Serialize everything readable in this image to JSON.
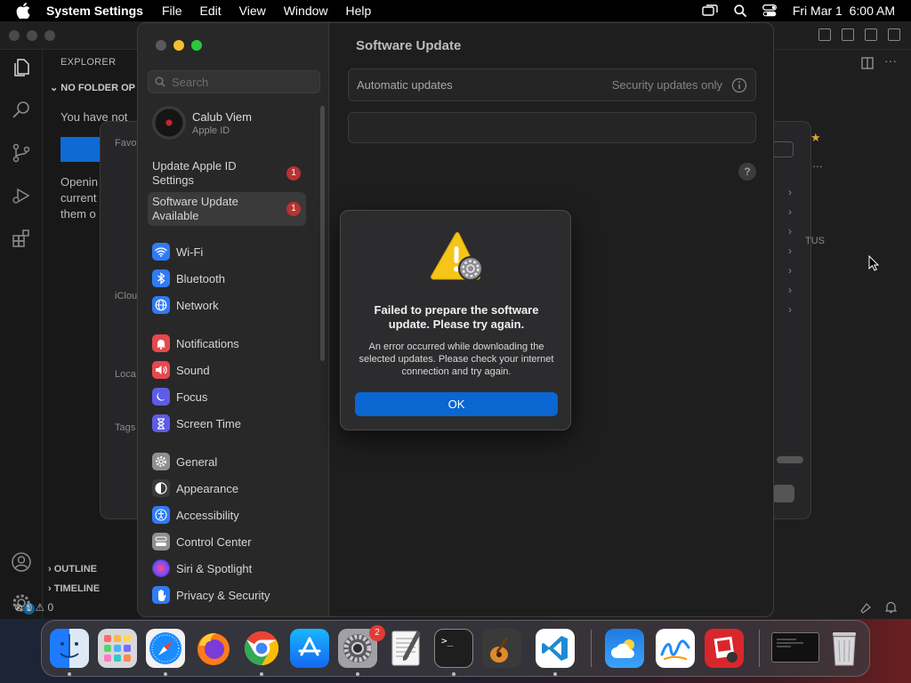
{
  "menubar": {
    "app_name": "System Settings",
    "menus": [
      "File",
      "Edit",
      "View",
      "Window",
      "Help"
    ],
    "datetime": "Fri Mar 1  6:00 AM"
  },
  "vscode": {
    "explorer_title": "EXPLORER",
    "folder_header": "NO FOLDER OP",
    "no_folder_text": "You have not",
    "opening_text_lines": [
      "Openin",
      "current",
      "them o"
    ],
    "outline": "OUTLINE",
    "timeline": "TIMELINE",
    "status": "⊗ 0 ⚠ 0",
    "accounts_badge": "1"
  },
  "finder": {
    "labels": [
      "Favo",
      "iClou",
      "Loca",
      "Tags"
    ],
    "tus": "TUS"
  },
  "settings": {
    "search_placeholder": "Search",
    "account": {
      "name": "Calub Viem",
      "subtitle": "Apple ID"
    },
    "notices": [
      {
        "label": "Update Apple ID Settings",
        "badge": "1"
      },
      {
        "label": "Software Update Available",
        "badge": "1"
      }
    ],
    "nav": [
      {
        "label": "Wi-Fi",
        "icon": "wifi-icon",
        "color": "#2f7bf5"
      },
      {
        "label": "Bluetooth",
        "icon": "bluetooth-icon",
        "color": "#2f7bf5"
      },
      {
        "label": "Network",
        "icon": "globe-icon",
        "color": "#2f7bf5"
      },
      {
        "label": "Notifications",
        "icon": "bell-icon",
        "color": "#e5484d"
      },
      {
        "label": "Sound",
        "icon": "speaker-icon",
        "color": "#e5484d"
      },
      {
        "label": "Focus",
        "icon": "moon-icon",
        "color": "#5e5ce6"
      },
      {
        "label": "Screen Time",
        "icon": "hourglass-icon",
        "color": "#5e5ce6"
      },
      {
        "label": "General",
        "icon": "gear-icon",
        "color": "#8e8e93"
      },
      {
        "label": "Appearance",
        "icon": "appearance-icon",
        "color": "#3a3a3c"
      },
      {
        "label": "Accessibility",
        "icon": "accessibility-icon",
        "color": "#2f7bf5"
      },
      {
        "label": "Control Center",
        "icon": "control-center-icon",
        "color": "#8e8e93"
      },
      {
        "label": "Siri & Spotlight",
        "icon": "siri-icon",
        "color": "#bf5af2"
      },
      {
        "label": "Privacy & Security",
        "icon": "hand-icon",
        "color": "#2f7bf5"
      }
    ],
    "content_title": "Software Update",
    "auto_updates_label": "Automatic updates",
    "auto_updates_value": "Security updates only",
    "help": "?"
  },
  "alert": {
    "title": "Failed to prepare the software update. Please try again.",
    "message": "An error occurred while downloading the selected updates. Please check your internet connection and try again.",
    "ok_label": "OK"
  },
  "dock": {
    "apps": [
      "Finder",
      "Launchpad",
      "Safari",
      "Firefox",
      "Chrome",
      "App Store",
      "System Settings",
      "TextEdit",
      "Terminal",
      "GarageBand",
      "Visual Studio Code",
      "Weather",
      "Freeform",
      "Photo Booth"
    ],
    "settings_badge": "2"
  },
  "colors": {
    "accent": "#0a66d0",
    "badge_red": "#b83232",
    "warning_yellow": "#f5c518"
  }
}
